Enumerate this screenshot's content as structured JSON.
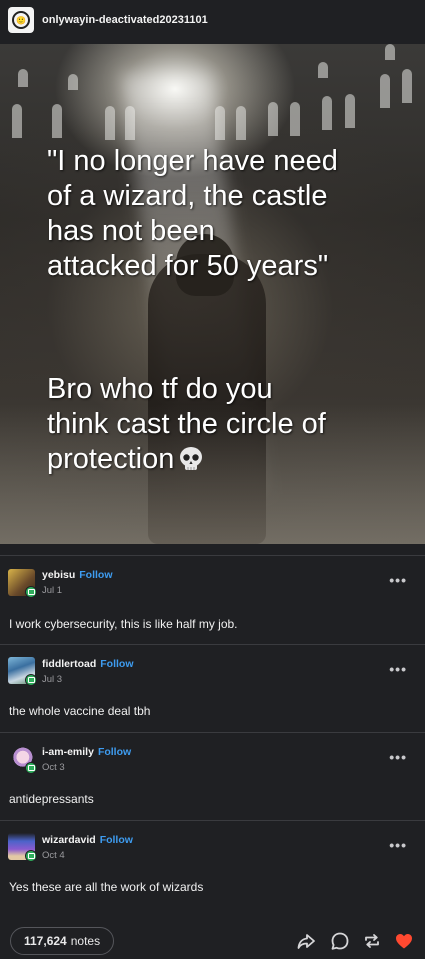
{
  "post": {
    "author": "onlywayin-deactivated20231101",
    "image": {
      "quote_text": "\"I no longer have need\nof a wizard, the castle\nhas not been\nattacked for 50 years\"",
      "punchline_text": "Bro who tf do you\nthink cast the circle of\nprotection",
      "emoji": "skull"
    }
  },
  "reblogs": [
    {
      "username": "yebisu",
      "follow_label": "Follow",
      "date": "Jul 1",
      "text": "I work cybersecurity, this is like half my job."
    },
    {
      "username": "fiddlertoad",
      "follow_label": "Follow",
      "date": "Jul 3",
      "text": "the whole vaccine deal tbh"
    },
    {
      "username": "i-am-emily",
      "follow_label": "Follow",
      "date": "Oct 3",
      "text": "antidepressants"
    },
    {
      "username": "wizardavid",
      "follow_label": "Follow",
      "date": "Oct 4",
      "text": "Yes these are all the work of wizards"
    }
  ],
  "footer": {
    "notes_count": "117,624",
    "notes_label": "notes",
    "icons": [
      "share-icon",
      "reply-icon",
      "reblog-icon",
      "like-icon"
    ],
    "like_color": "#ff4930"
  },
  "colors": {
    "follow_link": "#3e9cf0",
    "background": "#1f2023",
    "reblog_badge": "#2ead5c"
  }
}
